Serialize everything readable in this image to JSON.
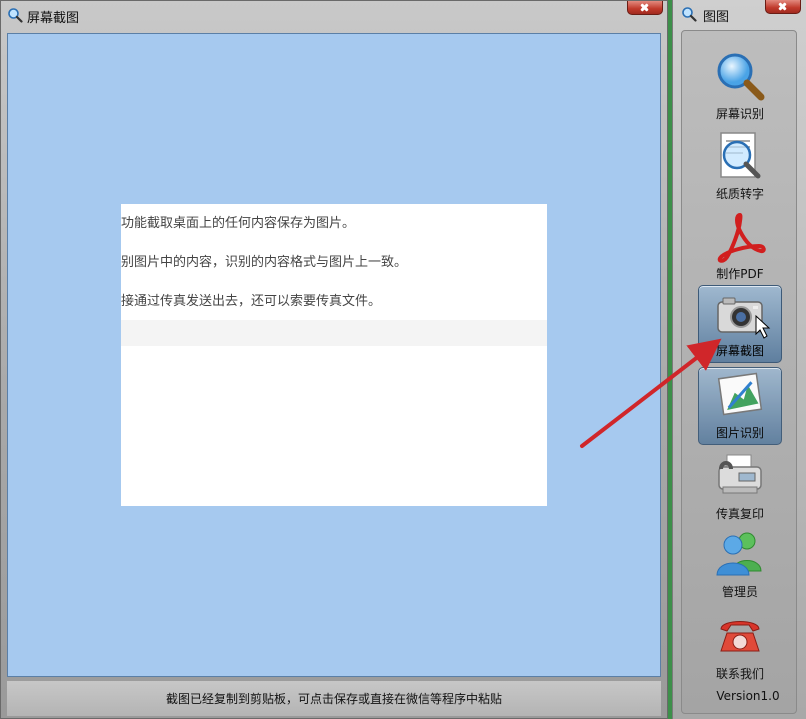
{
  "main_window": {
    "title": "屏幕截图",
    "status": "截图已经复制到剪贴板，可点击保存或直接在微信等程序中粘贴"
  },
  "screenshot": {
    "lines": [
      "功能截取桌面上的任何内容保存为图片。",
      "别图片中的内容，识别的内容格式与图片上一致。",
      "接通过传真发送出去，还可以索要传真文件。"
    ]
  },
  "side_panel": {
    "title": "图图",
    "tools": [
      {
        "label": "屏幕识别",
        "icon": "magnifier-icon"
      },
      {
        "label": "纸质转字",
        "icon": "document-scan-icon"
      },
      {
        "label": "制作PDF",
        "icon": "pdf-icon"
      },
      {
        "label": "屏幕截图",
        "icon": "camera-icon",
        "active": true
      },
      {
        "label": "图片识别",
        "icon": "picture-icon"
      },
      {
        "label": "传真复印",
        "icon": "fax-icon"
      },
      {
        "label": "管理员",
        "icon": "users-icon"
      },
      {
        "label": "联系我们",
        "icon": "telephone-icon"
      }
    ],
    "version": "Version1.0"
  },
  "colors": {
    "canvas": "#a6c9ef",
    "accent_arrow": "#d0262a",
    "active_tool": "#6f8eab"
  }
}
